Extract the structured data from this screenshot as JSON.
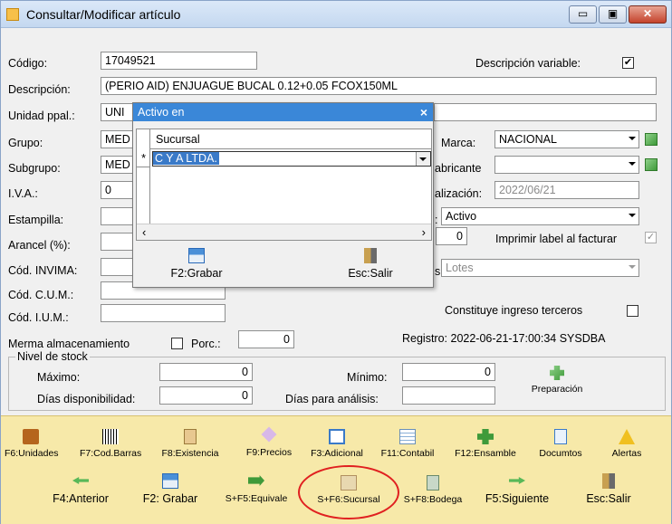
{
  "window": {
    "title": "Consultar/Modificar artículo",
    "min": "▭",
    "max": "▣",
    "close": "✕"
  },
  "form": {
    "codigo_label": "Código:",
    "codigo": "17049521",
    "desc_var_label": "Descripción variable:",
    "desc_var_checked": "✔",
    "descripcion_label": "Descripción:",
    "descripcion": "(PERIO AID) ENJUAGUE BUCAL 0.12+0.05 FCOX150ML",
    "unidad_label": "Unidad ppal.:",
    "unidad": "UNI",
    "grupo_label": "Grupo:",
    "grupo": "MED",
    "subgrupo_label": "Subgrupo:",
    "subgrupo": "MED",
    "iva_label": "I.V.A.:",
    "iva": "0",
    "estampilla_label": "Estampilla:",
    "arancel_label": "Arancel (%):",
    "invima_label": "Cód. INVIMA:",
    "cum_label": "Cód. C.U.M.:",
    "ium_label": "Cód. I.U.M.:",
    "marca_label": "Marca:",
    "marca": "NACIONAL",
    "fabricante_label": "abricante",
    "actualizacion_label": "alización:",
    "actualizacion": "2022/06/21",
    "estado_label": ":",
    "estado": "Activo",
    "cantidad": "0",
    "imprimir_label": "Imprimir label al facturar",
    "imprimir_checked": "✓",
    "control_label": "s:",
    "control": "Lotes",
    "terceros_label": "Constituye ingreso terceros",
    "merma_label": "Merma almacenamiento",
    "porc_label": "Porc.:",
    "porc": "0",
    "registro": "Registro: 2022-06-21-17:00:34 SYSDBA"
  },
  "stock": {
    "legend": "Nivel de stock",
    "maximo_label": "Máximo:",
    "maximo": "0",
    "minimo_label": "Mínimo:",
    "minimo": "0",
    "dias_disp_label": "Días disponibilidad:",
    "dias_disp": "0",
    "dias_analisis_label": "Días para análisis:",
    "preparacion": "Preparación"
  },
  "popup": {
    "title": "Activo en",
    "close": "×",
    "column": "Sucursal",
    "row_marker": "*",
    "row_value": "C Y A LTDA.",
    "save": "F2:Grabar",
    "exit": "Esc:Salir"
  },
  "toolbar1": [
    {
      "label": "F6:Unidades",
      "icon": "box-icon"
    },
    {
      "label": "F7:Cod.Barras",
      "icon": "barcode-icon"
    },
    {
      "label": "F8:Existencia",
      "icon": "clipboard-icon"
    },
    {
      "label": "F9:Precios",
      "icon": "tag-icon"
    },
    {
      "label": "F3:Adicional",
      "icon": "window-icon"
    },
    {
      "label": "F11:Contabil",
      "icon": "ledger-icon"
    },
    {
      "label": "F12:Ensamble",
      "icon": "puzzle-icon"
    },
    {
      "label": "Documtos",
      "icon": "document-icon"
    },
    {
      "label": "Alertas",
      "icon": "warning-icon"
    }
  ],
  "toolbar2": [
    {
      "label": "F4:Anterior",
      "icon": "arrow-left-icon"
    },
    {
      "label": "F2: Grabar",
      "icon": "save-icon"
    },
    {
      "label": "S+F5:Equivale",
      "icon": "equivalent-icon"
    },
    {
      "label": "S+F6:Sucursal",
      "icon": "branch-icon"
    },
    {
      "label": "S+F8:Bodega",
      "icon": "warehouse-icon"
    },
    {
      "label": "F5:Siguiente",
      "icon": "arrow-right-icon"
    },
    {
      "label": "Esc:Salir",
      "icon": "exit-door-icon"
    }
  ]
}
